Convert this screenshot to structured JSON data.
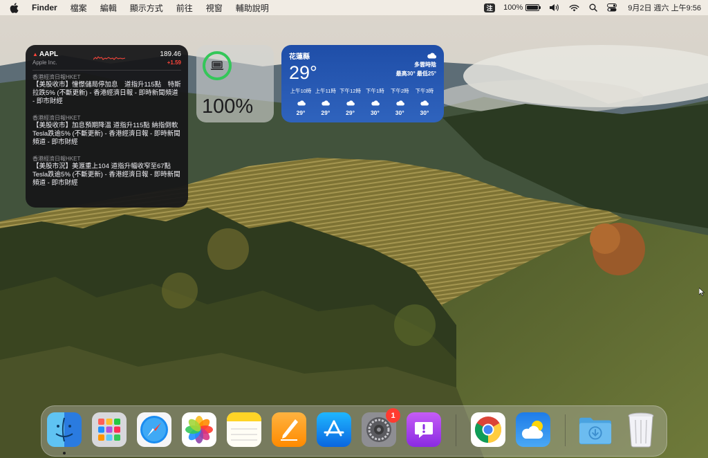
{
  "menubar": {
    "app_name": "Finder",
    "items": [
      "檔案",
      "編輯",
      "顯示方式",
      "前往",
      "視窗",
      "輔助說明"
    ],
    "ime": "注",
    "battery_percent_text": "100%",
    "battery_level": 1.0,
    "clock": "9月2日 週六 上午9:56"
  },
  "stocks": {
    "symbol": "AAPL",
    "name": "Apple Inc.",
    "price": "189.46",
    "change": "+1.59",
    "change_color": "#ff453a"
  },
  "news": [
    {
      "source": "香港經濟日報HKET",
      "headline": "【美股收市】憧憬儲局停加息　道指升115點　特斯拉跌5% (不斷更新) - 香港經濟日報 - 即時新聞頻道 - 即市財經"
    },
    {
      "source": "香港經濟日報HKET",
      "headline": "【美股收市】加息預期降溫 道指升115點 納指倒軟 Tesla跌逾5% (不斷更新) - 香港經濟日報 - 即時新聞頻道 - 即市財經"
    },
    {
      "source": "香港經濟日報HKET",
      "headline": "【美股市況】美滙重上104 道指升幅收窄至67點 Tesla跌逾5% (不斷更新) - 香港經濟日報 - 即時新聞頻道 - 即市財經"
    }
  ],
  "battery_widget": {
    "percent_text": "100%",
    "level": 1.0,
    "ring_color": "#34c759",
    "device_icon": "laptop-icon"
  },
  "weather": {
    "location": "花蓮縣",
    "temperature": "29°",
    "condition": "多雲時陰",
    "high_low": "最高30° 最低25°",
    "hourly": [
      {
        "time": "上午10時",
        "temp": "29°",
        "icon": "cloud-icon"
      },
      {
        "time": "上午11時",
        "temp": "29°",
        "icon": "cloud-icon"
      },
      {
        "time": "下午12時",
        "temp": "29°",
        "icon": "cloud-icon"
      },
      {
        "time": "下午1時",
        "temp": "30°",
        "icon": "cloud-icon"
      },
      {
        "time": "下午2時",
        "temp": "30°",
        "icon": "cloud-icon"
      },
      {
        "time": "下午3時",
        "temp": "30°",
        "icon": "cloud-icon"
      }
    ]
  },
  "dock": {
    "apps": [
      {
        "name": "Finder",
        "icon": "finder-icon",
        "running": true
      },
      {
        "name": "Launchpad",
        "icon": "launchpad-icon",
        "running": false
      },
      {
        "name": "Safari",
        "icon": "safari-icon",
        "running": false
      },
      {
        "name": "Photos",
        "icon": "photos-icon",
        "running": false
      },
      {
        "name": "Notes",
        "icon": "notes-icon",
        "running": false
      },
      {
        "name": "Pages",
        "icon": "pages-icon",
        "running": false
      },
      {
        "name": "App Store",
        "icon": "app-store-icon",
        "running": false
      },
      {
        "name": "System Settings",
        "icon": "system-settings-icon",
        "running": false,
        "badge": "1"
      },
      {
        "name": "Feedback Assistant",
        "icon": "feedback-icon",
        "running": false
      },
      {
        "name": "Google Chrome",
        "icon": "chrome-icon",
        "running": false
      },
      {
        "name": "Weather",
        "icon": "weather-icon",
        "running": false
      },
      {
        "name": "Downloads",
        "icon": "downloads-folder-icon",
        "running": false
      },
      {
        "name": "Trash",
        "icon": "trash-icon",
        "running": false
      }
    ]
  }
}
